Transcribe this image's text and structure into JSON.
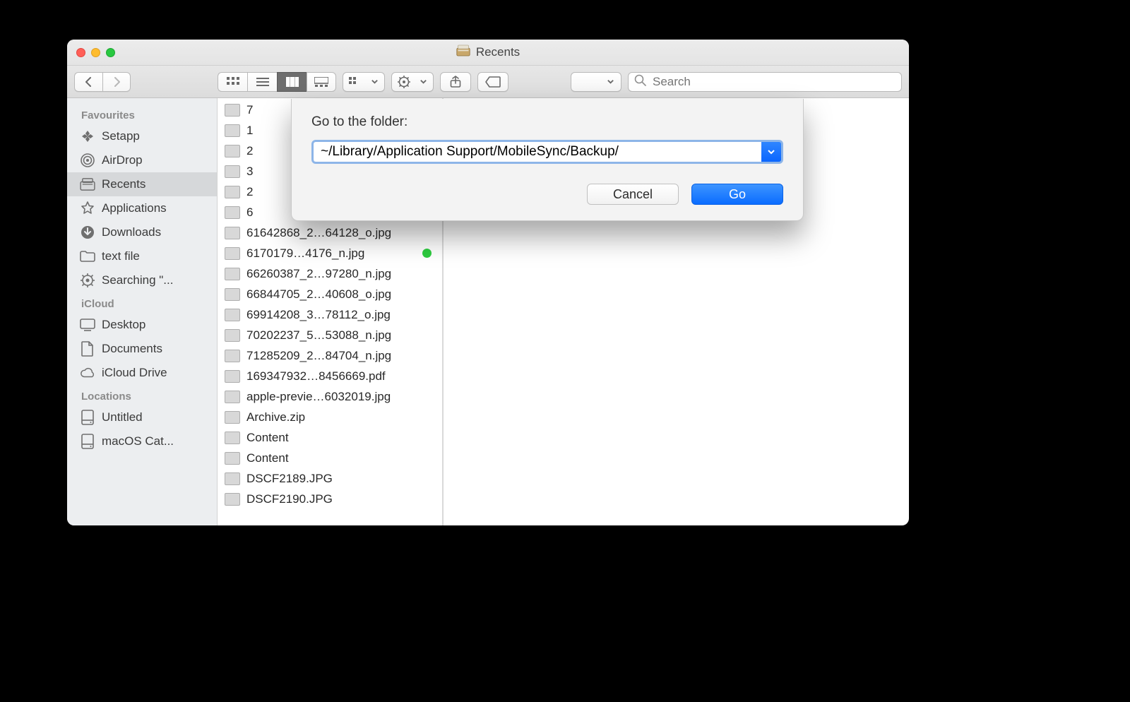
{
  "window": {
    "title": "Recents"
  },
  "toolbar": {
    "search_placeholder": "Search"
  },
  "sidebar": {
    "sections": [
      {
        "heading": "Favourites",
        "items": [
          {
            "icon": "setapp",
            "label": "Setapp",
            "selected": false
          },
          {
            "icon": "airdrop",
            "label": "AirDrop",
            "selected": false
          },
          {
            "icon": "recents",
            "label": "Recents",
            "selected": true
          },
          {
            "icon": "apps",
            "label": "Applications",
            "selected": false
          },
          {
            "icon": "downloads",
            "label": "Downloads",
            "selected": false
          },
          {
            "icon": "folder",
            "label": "text file",
            "selected": false
          },
          {
            "icon": "gear",
            "label": "Searching \"...",
            "selected": false
          }
        ]
      },
      {
        "heading": "iCloud",
        "items": [
          {
            "icon": "desktop",
            "label": "Desktop",
            "selected": false
          },
          {
            "icon": "documents",
            "label": "Documents",
            "selected": false
          },
          {
            "icon": "cloud",
            "label": "iCloud Drive",
            "selected": false
          }
        ]
      },
      {
        "heading": "Locations",
        "items": [
          {
            "icon": "disk",
            "label": "Untitled",
            "selected": false
          },
          {
            "icon": "disk",
            "label": "macOS Cat...",
            "selected": false
          }
        ]
      }
    ]
  },
  "files": [
    {
      "name": "7"
    },
    {
      "name": "1"
    },
    {
      "name": "2"
    },
    {
      "name": "3"
    },
    {
      "name": "2"
    },
    {
      "name": "6"
    },
    {
      "name": "61642868_2…64128_o.jpg"
    },
    {
      "name": "6170179…4176_n.jpg",
      "tag": "green"
    },
    {
      "name": "66260387_2…97280_n.jpg"
    },
    {
      "name": "66844705_2…40608_o.jpg"
    },
    {
      "name": "69914208_3…78112_o.jpg"
    },
    {
      "name": "70202237_5…53088_n.jpg"
    },
    {
      "name": "71285209_2…84704_n.jpg"
    },
    {
      "name": "169347932…8456669.pdf"
    },
    {
      "name": "apple-previe…6032019.jpg"
    },
    {
      "name": "Archive.zip"
    },
    {
      "name": "Content"
    },
    {
      "name": "Content"
    },
    {
      "name": "DSCF2189.JPG"
    },
    {
      "name": "DSCF2190.JPG"
    }
  ],
  "sheet": {
    "label": "Go to the folder:",
    "path": "~/Library/Application Support/MobileSync/Backup/",
    "cancel": "Cancel",
    "go": "Go"
  }
}
